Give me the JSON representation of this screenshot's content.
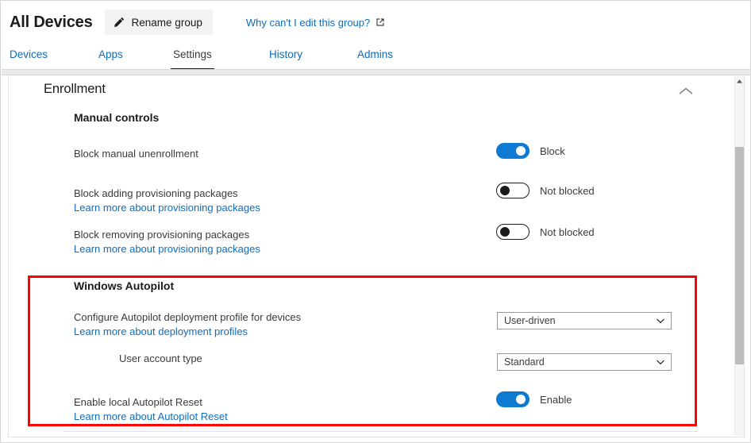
{
  "header": {
    "title": "All Devices",
    "rename_button_label": "Rename group",
    "rename_button_icon": "pencil-icon",
    "why_link_label": "Why can't I edit this group?",
    "why_link_icon": "external-link-icon"
  },
  "tabs": [
    {
      "label": "Devices",
      "active": false
    },
    {
      "label": "Apps",
      "active": false
    },
    {
      "label": "Settings",
      "active": true
    },
    {
      "label": "History",
      "active": false
    },
    {
      "label": "Admins",
      "active": false
    }
  ],
  "content": {
    "section_title": "Enrollment",
    "collapse_icon": "chevron-up-icon",
    "groups": [
      {
        "heading": "Manual controls",
        "settings": [
          {
            "label": "Block manual unenrollment",
            "sublink": null,
            "control": "toggle",
            "toggle_state": "on",
            "toggle_text": "Block"
          },
          {
            "label": "Block adding provisioning packages",
            "sublink": "Learn more about provisioning packages",
            "control": "toggle",
            "toggle_state": "off",
            "toggle_text": "Not blocked"
          },
          {
            "label": "Block removing provisioning packages",
            "sublink": "Learn more about provisioning packages",
            "control": "toggle",
            "toggle_state": "off",
            "toggle_text": "Not blocked"
          }
        ]
      },
      {
        "heading": "Windows Autopilot",
        "highlighted": true,
        "highlight_color": "#ff0000",
        "settings": [
          {
            "label": "Configure Autopilot deployment profile for devices",
            "sublink": "Learn more about deployment profiles",
            "control": "dropdown",
            "dropdown_value": "User-driven",
            "dropdown_icon": "chevron-down-icon"
          },
          {
            "label": "User account type",
            "sublink": null,
            "indented": true,
            "control": "dropdown",
            "dropdown_value": "Standard",
            "dropdown_icon": "chevron-down-icon"
          },
          {
            "label": "Enable local Autopilot Reset",
            "sublink": "Learn more about Autopilot Reset",
            "control": "toggle",
            "toggle_state": "on",
            "toggle_text": "Enable"
          }
        ]
      }
    ]
  },
  "scrollbar": {
    "up_arrow_icon": "scroll-up-arrow-icon"
  },
  "colors": {
    "accent_blue": "#0f7ad1",
    "link_blue": "#0f6cbd",
    "highlight_red": "#ff0000",
    "text_primary": "#1b1b1b",
    "text_secondary": "#3b3b3b"
  }
}
